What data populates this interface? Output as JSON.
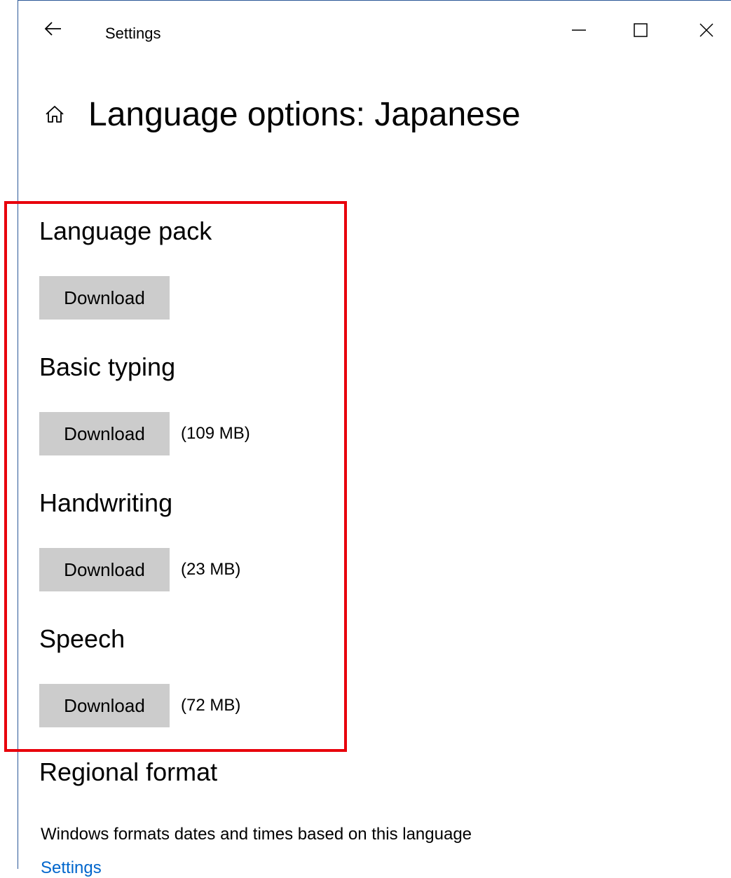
{
  "window": {
    "app_title": "Settings",
    "back_icon": "back-arrow-icon",
    "minimize_icon": "minimize-icon",
    "maximize_icon": "maximize-icon",
    "close_icon": "close-icon",
    "border_color": "#2b5797"
  },
  "header": {
    "home_icon": "home-icon",
    "title": "Language options: Japanese"
  },
  "sections": [
    {
      "title": "Language pack",
      "button_label": "Download",
      "size": ""
    },
    {
      "title": "Basic typing",
      "button_label": "Download",
      "size": "(109 MB)"
    },
    {
      "title": "Handwriting",
      "button_label": "Download",
      "size": "(23 MB)"
    },
    {
      "title": "Speech",
      "button_label": "Download",
      "size": "(72 MB)"
    }
  ],
  "regional": {
    "title": "Regional format",
    "description": "Windows formats dates and times based on this language",
    "link": "Settings"
  },
  "colors": {
    "highlight": "#e8000b",
    "button_bg": "#cccccc",
    "link": "#0066cc"
  }
}
